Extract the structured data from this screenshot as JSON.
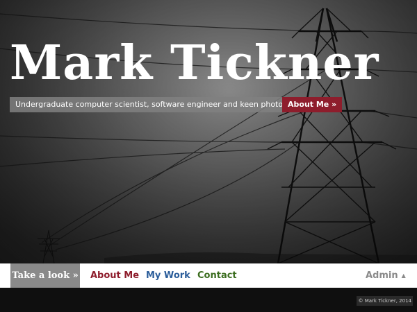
{
  "hero": {
    "title": "Mark Tickner",
    "tagline": "Undergraduate computer scientist, software engineer and keen photographer",
    "cta_label": "About Me »",
    "background_image": "black-and-white photo of electricity pylons and power lines"
  },
  "navbar": {
    "items": [
      {
        "label": "Take a look »",
        "active": true
      },
      {
        "label": "About Me",
        "color": "#8e1d2c"
      },
      {
        "label": "My Work",
        "color": "#2b5d9a"
      },
      {
        "label": "Contact",
        "color": "#3b6d1f"
      }
    ],
    "admin_label": "Admin",
    "admin_icon": "caret-up-icon"
  },
  "footer": {
    "copyright": "© Mark Tickner, 2014"
  },
  "colors": {
    "accent": "#8e1d2c",
    "tagline_bg": "#808080",
    "active_tab_bg": "#8a8a8a"
  }
}
